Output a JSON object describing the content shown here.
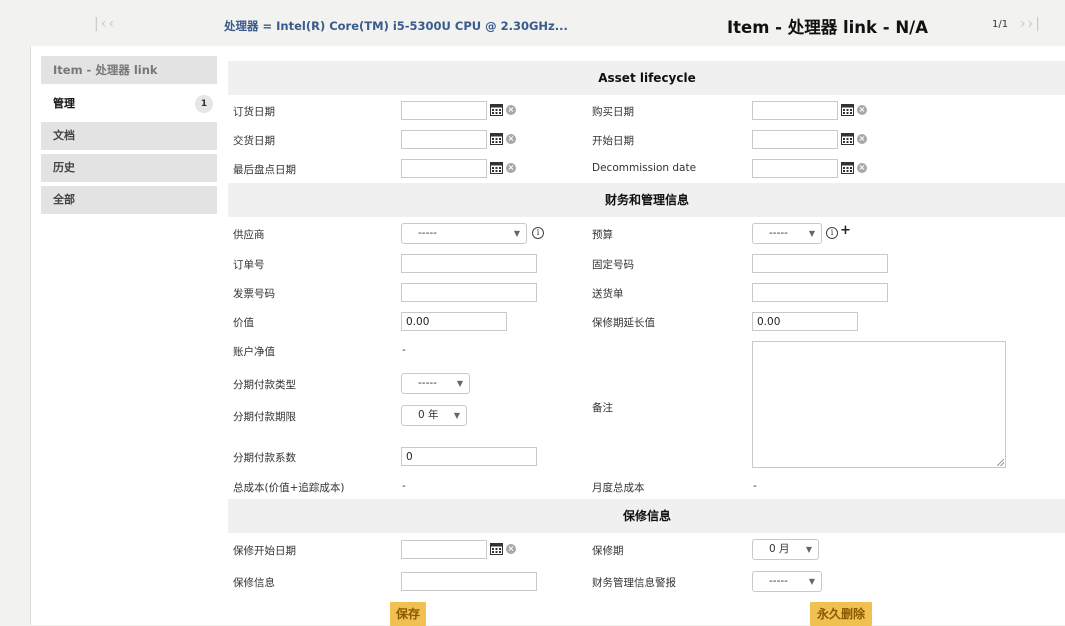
{
  "header": {
    "nav_first": "|‹",
    "nav_prev": "‹",
    "link": "处理器 = Intel(R) Core(TM) i5-5300U CPU @ 2.30GHz...",
    "title": "Item - 处理器 link - N/A",
    "pager": "1/1",
    "nav_next": "›",
    "nav_last": "›|"
  },
  "sidebar": {
    "header": "Item - 处理器 link",
    "items": [
      {
        "label": "管理",
        "badge": "1"
      },
      {
        "label": "文档"
      },
      {
        "label": "历史"
      },
      {
        "label": "全部"
      }
    ]
  },
  "sections": {
    "lifecycle": "Asset lifecycle",
    "financial": "财务和管理信息",
    "warranty": "保修信息"
  },
  "lifecycle": {
    "order_date": "订货日期",
    "purchase_date": "购买日期",
    "delivery_date": "交货日期",
    "start_date": "开始日期",
    "last_inventory_date": "最后盘点日期",
    "decommission_date": "Decommission date"
  },
  "financial": {
    "supplier": "供应商",
    "supplier_value": "-----",
    "budget": "预算",
    "budget_value": "-----",
    "order_number": "订单号",
    "immo_number": "固定号码",
    "invoice_number": "发票号码",
    "delivery_note": "送货单",
    "value": "价值",
    "value_input": "0.00",
    "warranty_extension_value": "保修期延长值",
    "warranty_extension_input": "0.00",
    "net_book_value": "账户净值",
    "net_book_value_text": "-",
    "amort_type": "分期付款类型",
    "amort_type_value": "-----",
    "amort_time": "分期付款期限",
    "amort_time_value": "0 年",
    "comment": "备注",
    "amort_coeff": "分期付款系数",
    "amort_coeff_value": "0",
    "tco": "总成本(价值+追踪成本)",
    "tco_value": "-",
    "monthly_tco": "月度总成本",
    "monthly_tco_value": "-"
  },
  "warranty": {
    "start_date": "保修开始日期",
    "duration": "保修期",
    "duration_value": "0 月",
    "info": "保修信息",
    "alert": "财务管理信息警报",
    "alert_value": "-----"
  },
  "buttons": {
    "save": "保存",
    "delete": "永久删除"
  },
  "icons": {
    "calendar": "calendar-icon",
    "clear": "clear-icon",
    "info": "info-icon",
    "plus": "plus-icon"
  },
  "colors": {
    "button_bg": "#f0c050",
    "link": "#3a5a8c"
  }
}
